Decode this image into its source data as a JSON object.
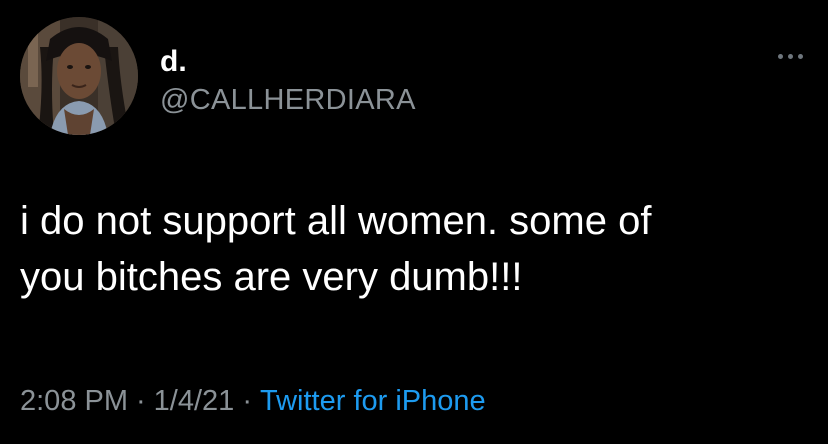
{
  "tweet": {
    "display_name": "d.",
    "handle": "@CALLHERDIARA",
    "more_icon": "more-horizontal-icon",
    "body_lines": [
      "i do not support all women. some of",
      "you bitches are very dumb!!!"
    ],
    "time": "2:08 PM",
    "date": "1/4/21",
    "separator": "·",
    "source": "Twitter for iPhone"
  },
  "colors": {
    "background": "#000000",
    "text_primary": "#ffffff",
    "text_secondary": "#8b9297",
    "link": "#1d9bf0"
  }
}
